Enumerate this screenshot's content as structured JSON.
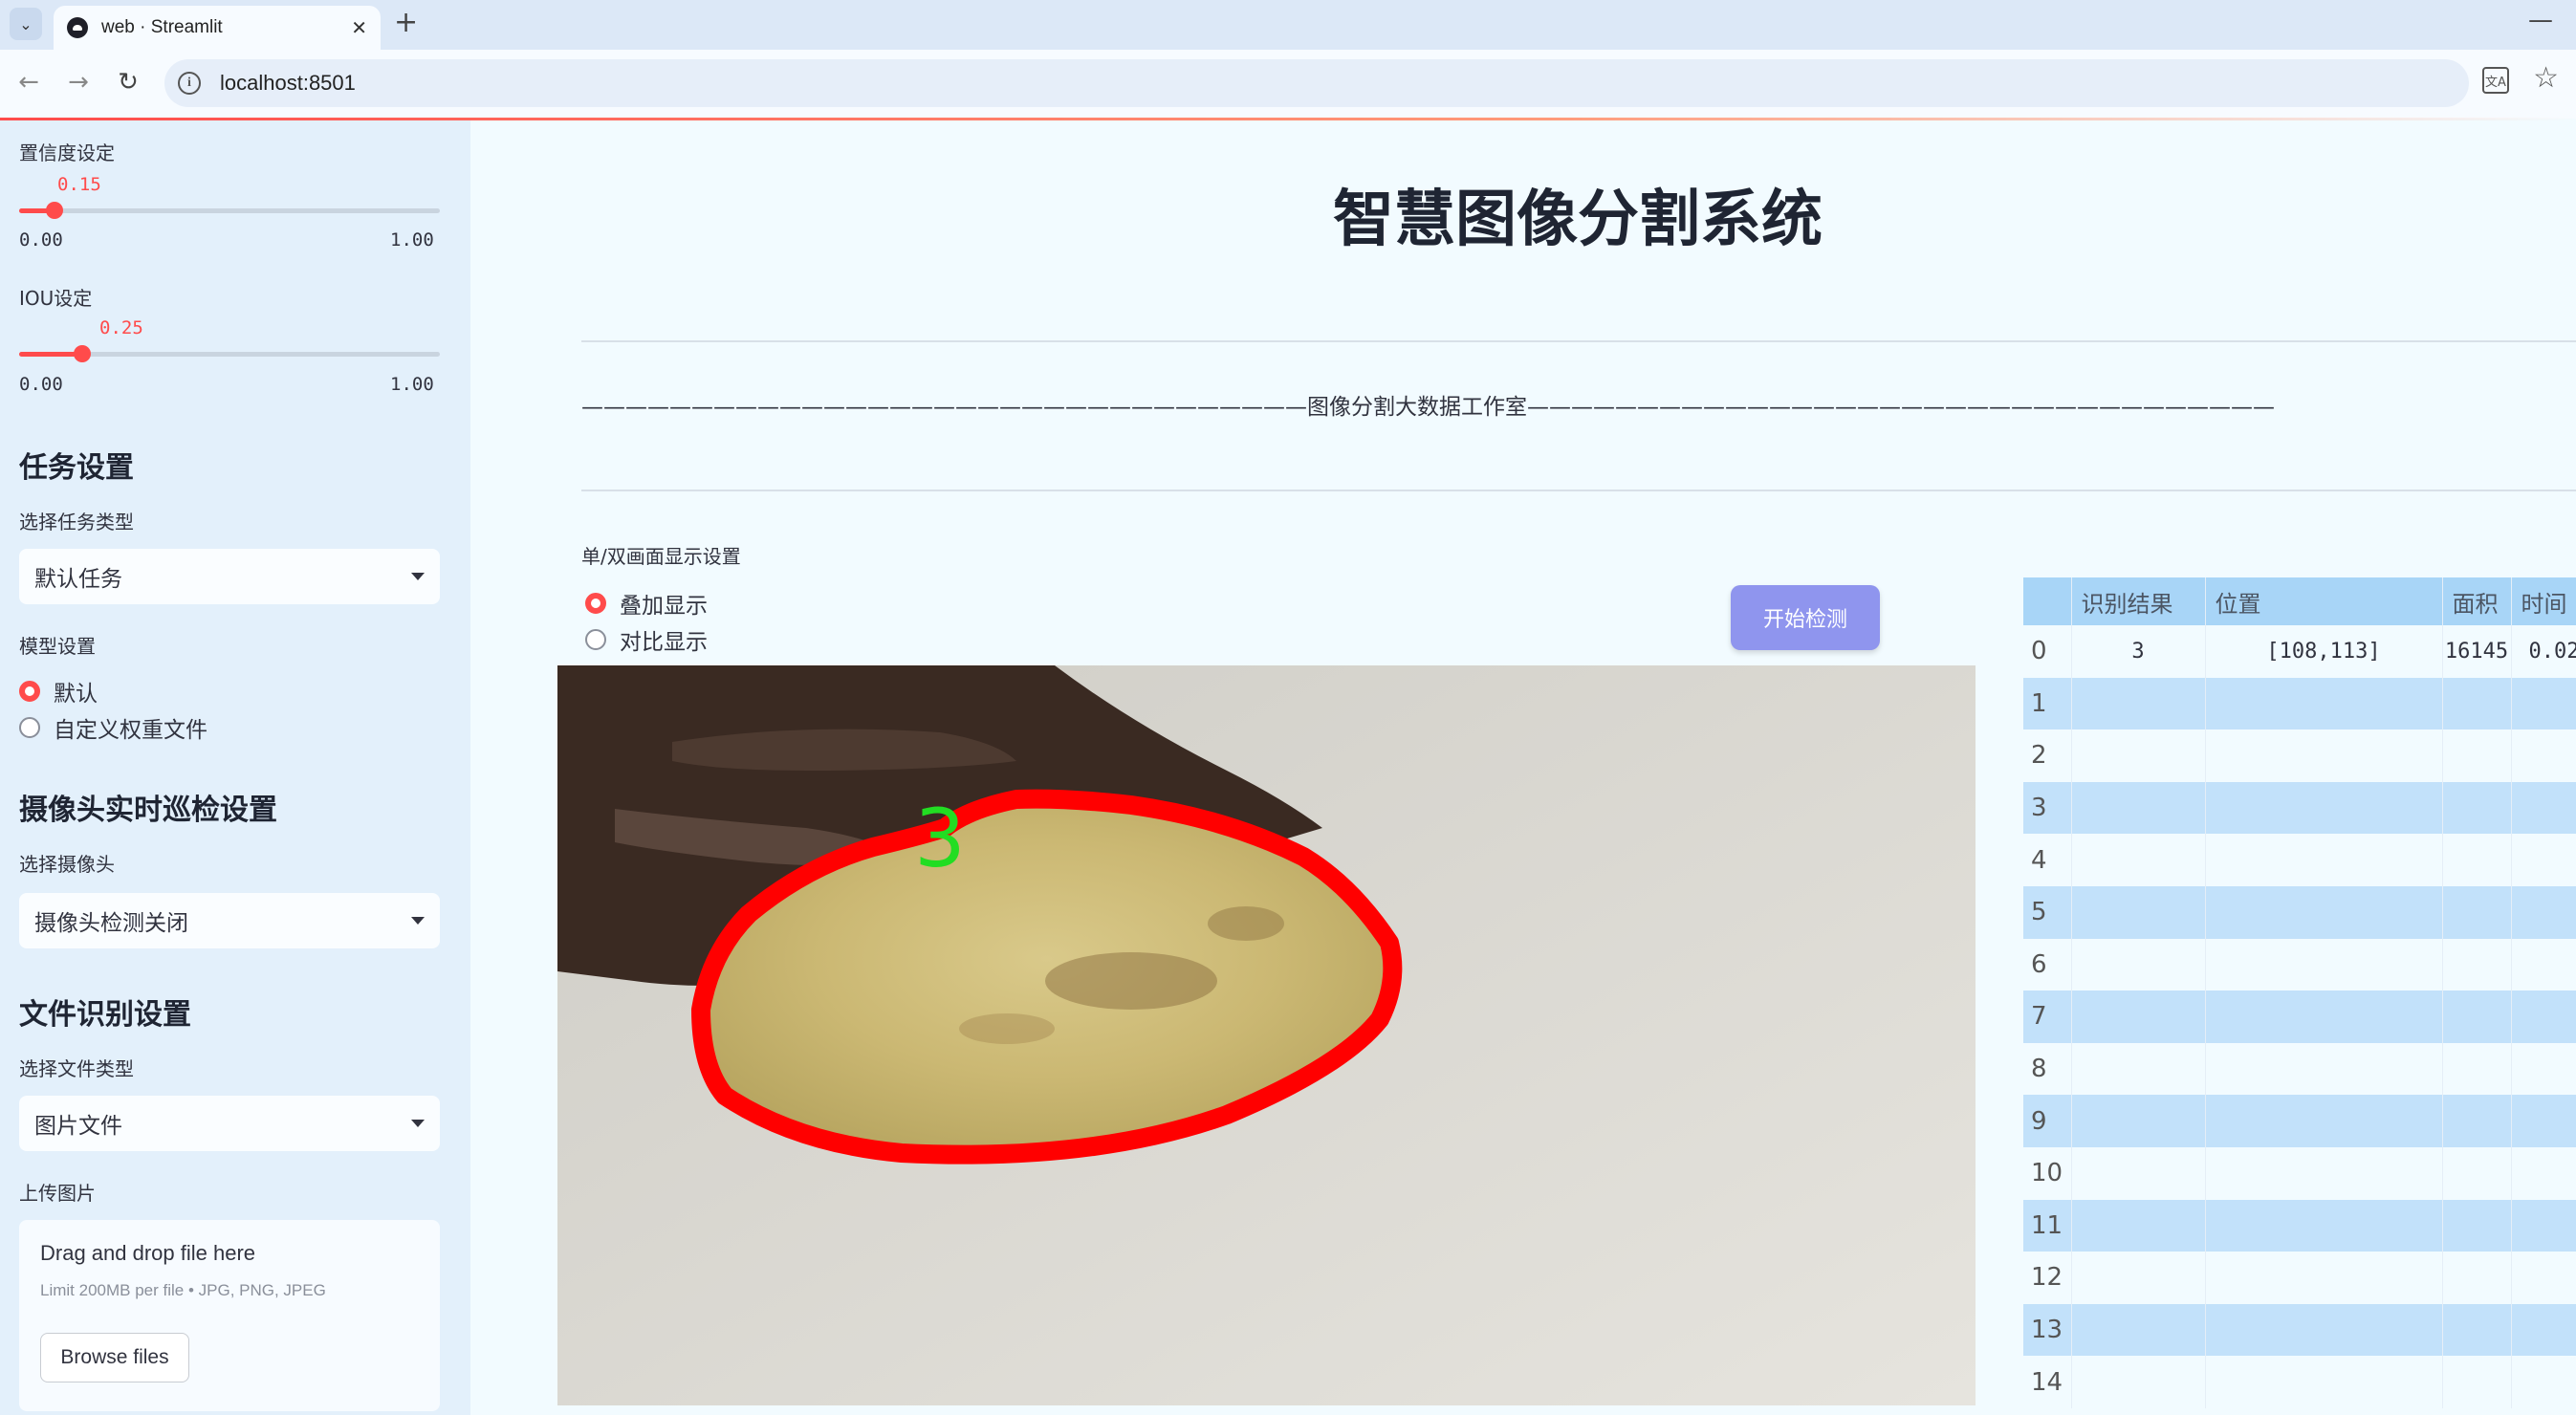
{
  "browser": {
    "tab_title": "web · Streamlit",
    "url": "localhost:8501"
  },
  "sidebar": {
    "conf_label": "置信度设定",
    "conf_value": "0.15",
    "conf_fraction": 0.15,
    "conf_min": "0.00",
    "conf_max": "1.00",
    "iou_label": "IOU设定",
    "iou_value": "0.25",
    "iou_fraction": 0.25,
    "iou_min": "0.00",
    "iou_max": "1.00",
    "task_header": "任务设置",
    "task_type_label": "选择任务类型",
    "task_type_value": "默认任务",
    "model_label": "模型设置",
    "model_options": [
      "默认",
      "自定义权重文件"
    ],
    "model_selected": "默认",
    "camera_header": "摄像头实时巡检设置",
    "camera_label": "选择摄像头",
    "camera_value": "摄像头检测关闭",
    "file_header": "文件识别设置",
    "file_type_label": "选择文件类型",
    "file_type_value": "图片文件",
    "upload_label": "上传图片",
    "upload_title": "Drag and drop file here",
    "upload_sub": "Limit 200MB per file • JPG, PNG, JPEG",
    "browse_label": "Browse files"
  },
  "main": {
    "title": "智慧图像分割系统",
    "divider_text": "—————————————————————————————————图像分割大数据工作室——————————————————————————————————",
    "display_mode_label": "单/双画面显示设置",
    "display_options": [
      "叠加显示",
      "对比显示"
    ],
    "display_selected": "叠加显示",
    "start_button": "开始检测",
    "detection_label": "3"
  },
  "table": {
    "columns": [
      "识别结果",
      "位置",
      "面积",
      "时间"
    ],
    "rows": [
      {
        "index": "0",
        "result": "3",
        "position": "[108,113]",
        "area": "16145",
        "time": "0.02"
      },
      {
        "index": "1"
      },
      {
        "index": "2"
      },
      {
        "index": "3"
      },
      {
        "index": "4"
      },
      {
        "index": "5"
      },
      {
        "index": "6"
      },
      {
        "index": "7"
      },
      {
        "index": "8"
      },
      {
        "index": "9"
      },
      {
        "index": "10"
      },
      {
        "index": "11"
      },
      {
        "index": "12"
      },
      {
        "index": "13"
      },
      {
        "index": "14"
      }
    ]
  },
  "colors": {
    "accent": "#ff4b4b",
    "button": "#8f95ee",
    "table_header": "#a8d5f7",
    "table_stripe": "#c2e1fa",
    "mask_outline": "#ff0000",
    "mask_label": "#22dd22"
  }
}
